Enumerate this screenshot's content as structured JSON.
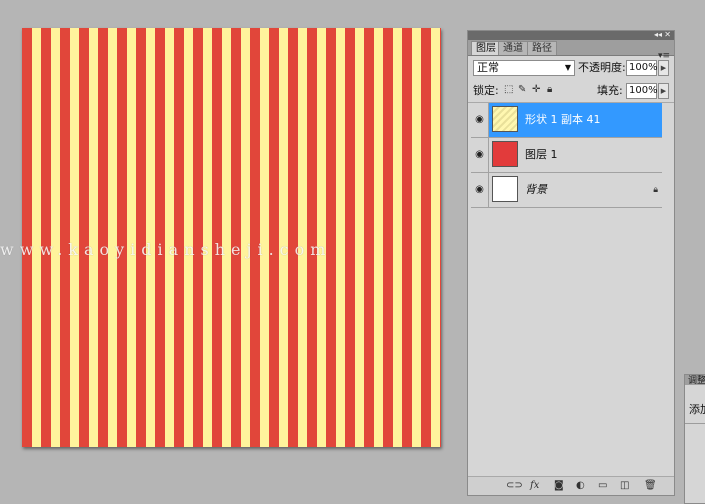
{
  "canvas": {
    "stripe_colors": [
      "#e1463a",
      "#fff39c"
    ],
    "watermark": "www.kaoyidiansheji.com"
  },
  "layers_panel": {
    "topbar": {
      "collapse": "◂◂",
      "close": "✕"
    },
    "tabs": [
      {
        "label": "图层",
        "active": true
      },
      {
        "label": "通道",
        "active": false
      },
      {
        "label": "路径",
        "active": false
      }
    ],
    "menu_icon": "▾≡",
    "blend_mode": "正常",
    "opacity_label": "不透明度:",
    "opacity_value": "100%",
    "lock_label": "锁定:",
    "lock_icons": [
      "transparency-lock-icon",
      "brush-lock-icon",
      "move-lock-icon",
      "padlock-icon"
    ],
    "fill_label": "填充:",
    "fill_value": "100%",
    "layers": [
      {
        "name": "形状 1 副本 41",
        "thumbnail": "yellow-pattern",
        "selected": true,
        "visible": true
      },
      {
        "name": "图层 1",
        "thumbnail": "red",
        "selected": false,
        "visible": true
      },
      {
        "name": "背景",
        "thumbnail": "white",
        "selected": false,
        "visible": true,
        "locked": true
      }
    ],
    "bottom_icons": [
      "link-icon",
      "fx-icon",
      "mask-icon",
      "adjustment-icon",
      "folder-icon",
      "new-layer-icon",
      "trash-icon"
    ]
  },
  "adjustments_panel": {
    "tab_label": "调整",
    "text": "添加"
  },
  "colors": {
    "selection": "#3399ff",
    "panel_bg": "#d6d6d6",
    "workspace_bg": "#b5b5b5"
  }
}
